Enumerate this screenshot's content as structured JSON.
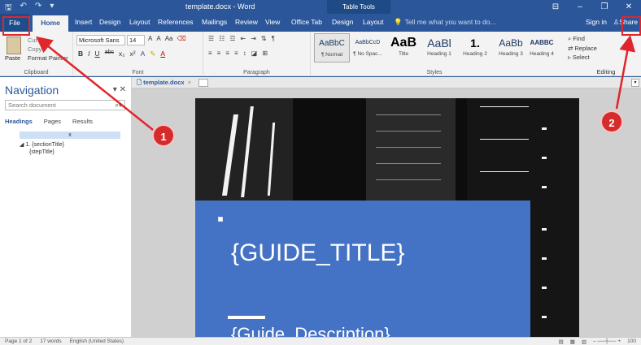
{
  "titlebar": {
    "doc_title": "template.docx - Word",
    "context_group": "Table Tools",
    "qat": [
      "save",
      "undo",
      "redo",
      "customize"
    ]
  },
  "tabs": {
    "file": "File",
    "home": "Home",
    "insert": "Insert",
    "design": "Design",
    "layout": "Layout",
    "references": "References",
    "mailings": "Mailings",
    "review": "Review",
    "view": "View",
    "office_tab": "Office Tab",
    "tt_design": "Design",
    "tt_layout": "Layout",
    "tell_me": "Tell me what you want to do...",
    "sign_in": "Sign in",
    "share": "Share"
  },
  "ribbon": {
    "clipboard": {
      "label": "Clipboard",
      "paste": "Paste",
      "cut": "Cut",
      "copy": "Copy",
      "format_painter": "Format Painter"
    },
    "font": {
      "label": "Font",
      "name": "Microsoft Sans",
      "size": "14",
      "buttons": [
        "B",
        "I",
        "U",
        "abc",
        "x₂",
        "x²",
        "A",
        "A"
      ],
      "grow_shrink": [
        "A",
        "A",
        "Aa"
      ]
    },
    "paragraph": {
      "label": "Paragraph"
    },
    "styles": {
      "label": "Styles",
      "items": [
        {
          "sample": "AaBbC",
          "name": "¶ Normal"
        },
        {
          "sample": "AaBbCcD",
          "name": "¶ No Spac..."
        },
        {
          "sample": "AaB",
          "name": "Title"
        },
        {
          "sample": "AaBl",
          "name": "Heading 1"
        },
        {
          "sample": "1.",
          "name": "Heading 2"
        },
        {
          "sample": "AaBb",
          "name": "Heading 3"
        },
        {
          "sample": "AABBC",
          "name": "Heading 4"
        }
      ]
    },
    "editing": {
      "label": "Editing",
      "find": "Find",
      "replace": "Replace",
      "select": "Select"
    }
  },
  "nav": {
    "title": "Navigation",
    "search_placeholder": "Search document",
    "tabs": [
      "Headings",
      "Pages",
      "Results"
    ],
    "selected_marker": "x",
    "tree": [
      {
        "label": "1. {sectionTitle}"
      },
      {
        "label": "{stepTitle}"
      }
    ]
  },
  "doc_tab": {
    "name": "template.docx",
    "close": "×"
  },
  "document": {
    "guide_title": "{GUIDE_TITLE}",
    "guide_description": "{Guide_Description}"
  },
  "status": {
    "page": "Page 1 of 2",
    "words": "17 words",
    "language": "English (United States)",
    "zoom": "100"
  },
  "annotations": {
    "step1": "1",
    "step2": "2",
    "color": "#e0262b"
  }
}
